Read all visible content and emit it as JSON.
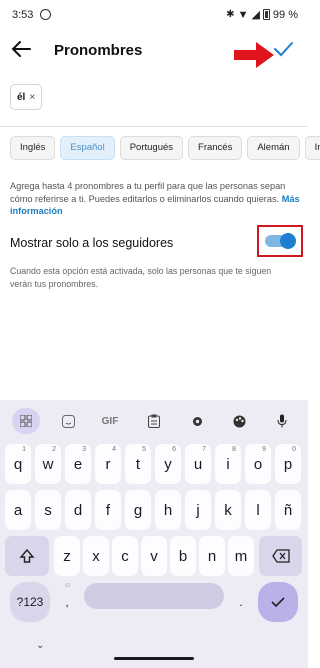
{
  "status": {
    "time": "3:53",
    "battery": "99 %"
  },
  "header": {
    "title": "Pronombres"
  },
  "chip": {
    "label": "él",
    "remove": "×"
  },
  "languages": [
    "Inglés",
    "Español",
    "Portugués",
    "Francés",
    "Alemán",
    "In"
  ],
  "active_language_index": 1,
  "info": {
    "text": "Agrega hasta 4 pronombres a tu perfil para que las personas sepan cómo referirse a ti. Puedes editarlos o eliminarlos cuando quieras.",
    "link": "Más información"
  },
  "followers": {
    "label": "Mostrar solo a los seguidores",
    "toggle_on": true,
    "description": "Cuando esta opción está activada, solo las personas que te siguen verán tus pronombres."
  },
  "keyboard": {
    "toolbar": [
      "grid-icon",
      "sticker-icon",
      "GIF",
      "clipboard-icon",
      "settings-icon",
      "palette-icon",
      "mic-icon"
    ],
    "gif_label": "GIF",
    "row1": [
      "q",
      "w",
      "e",
      "r",
      "t",
      "y",
      "u",
      "i",
      "o",
      "p"
    ],
    "row1_hints": [
      "1",
      "2",
      "3",
      "4",
      "5",
      "6",
      "7",
      "8",
      "9",
      "0"
    ],
    "row2": [
      "a",
      "s",
      "d",
      "f",
      "g",
      "h",
      "j",
      "k",
      "l",
      "ñ"
    ],
    "row3": [
      "z",
      "x",
      "c",
      "v",
      "b",
      "n",
      "m"
    ],
    "symbols_label": "?123",
    "comma": ",",
    "period": "."
  },
  "colors": {
    "accent": "#1f7ed0",
    "highlight": "#d01820"
  }
}
